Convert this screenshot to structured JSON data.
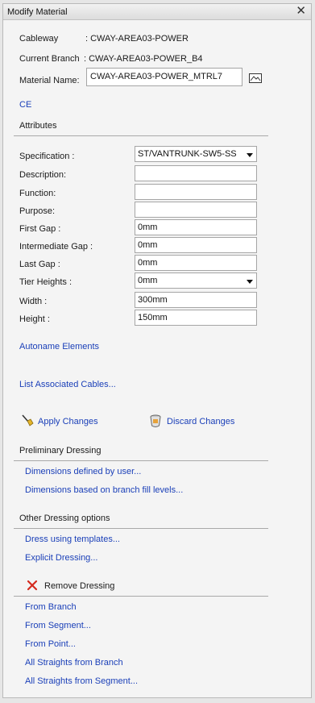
{
  "window": {
    "title": "Modify Material",
    "close_glyph": "✕"
  },
  "info": {
    "cableway_label": "Cableway",
    "cableway_value": ": CWAY-AREA03-POWER",
    "branch_label": "Current Branch",
    "branch_value": ": CWAY-AREA03-POWER_B4",
    "material_label": "Material Name:",
    "material_value": "CWAY-AREA03-POWER_MTRL7",
    "ce_link": "CE"
  },
  "attributes": {
    "header": "Attributes",
    "specification_label": "Specification :",
    "specification_value": "ST/VANTRUNK-SW5-SS",
    "description_label": "Description:",
    "description_value": "",
    "function_label": "Function:",
    "function_value": "",
    "purpose_label": "Purpose:",
    "purpose_value": "",
    "first_gap_label": "First Gap :",
    "first_gap_value": "0mm",
    "intermediate_gap_label": "Intermediate Gap :",
    "intermediate_gap_value": "0mm",
    "last_gap_label": "Last Gap :",
    "last_gap_value": "0mm",
    "tier_heights_label": "Tier Heights :",
    "tier_heights_value": "0mm",
    "width_label": "Width :",
    "width_value": "300mm",
    "height_label": "Height :",
    "height_value": "150mm"
  },
  "links": {
    "autoname": "Autoname Elements",
    "list_cables": "List Associated Cables..."
  },
  "actions": {
    "apply": "Apply Changes",
    "discard": "Discard Changes"
  },
  "preliminary": {
    "header": "Preliminary Dressing",
    "items": [
      "Dimensions defined by user...",
      "Dimensions based on branch fill levels..."
    ]
  },
  "other": {
    "header": "Other Dressing options",
    "items": [
      "Dress using templates...",
      "Explicit Dressing..."
    ]
  },
  "remove": {
    "header": "Remove Dressing",
    "items": [
      "From Branch",
      "From Segment...",
      "From Point...",
      "All Straights from Branch",
      "All Straights from Segment..."
    ]
  },
  "colors": {
    "link": "#1a3fb8",
    "remove_icon": "#d42a1e",
    "panel_bg": "#f4f4f4"
  }
}
